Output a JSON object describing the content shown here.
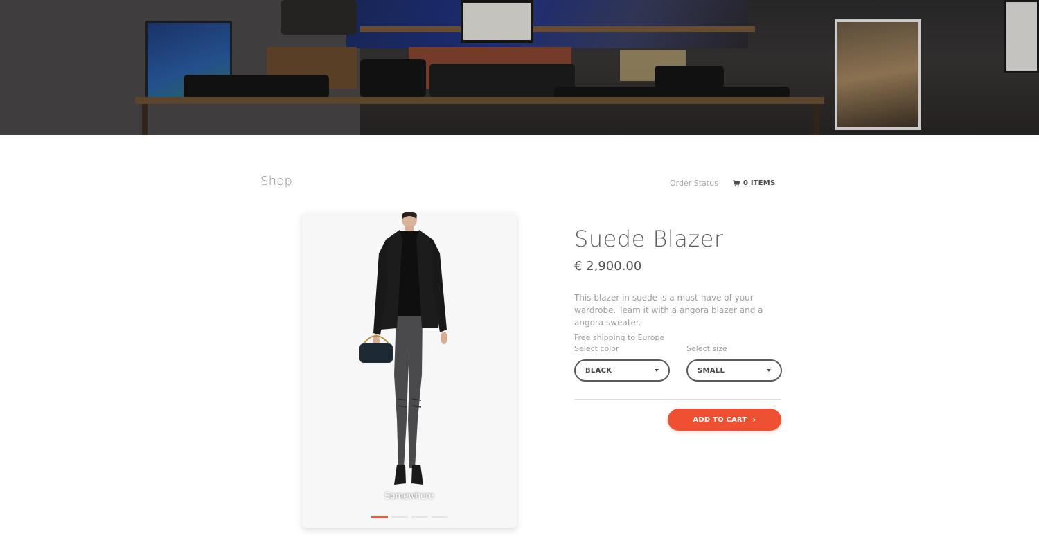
{
  "hero": {
    "image": "shop-interior-banner"
  },
  "header": {
    "brand": "Shop",
    "order_status": "Order Status",
    "cart_icon": "shopping-cart-icon",
    "cart_label": "0 ITEMS"
  },
  "gallery": {
    "image": "model-wearing-black-suede-blazer",
    "caption": "Somewhere",
    "slides": 4,
    "active_slide": 1
  },
  "product": {
    "title": "Suede Blazer",
    "price": "€ 2,900.00",
    "description": "This blazer in suede is a must-have of your wardrobe. Team it with a angora blazer and a angora sweater.",
    "shipping": "Free shipping to Europe",
    "color_label": "Select color",
    "color_value": "BLACK",
    "size_label": "Select size",
    "size_value": "SMALL",
    "add_to_cart": "ADD TO CART",
    "accent_color": "#f05032"
  }
}
